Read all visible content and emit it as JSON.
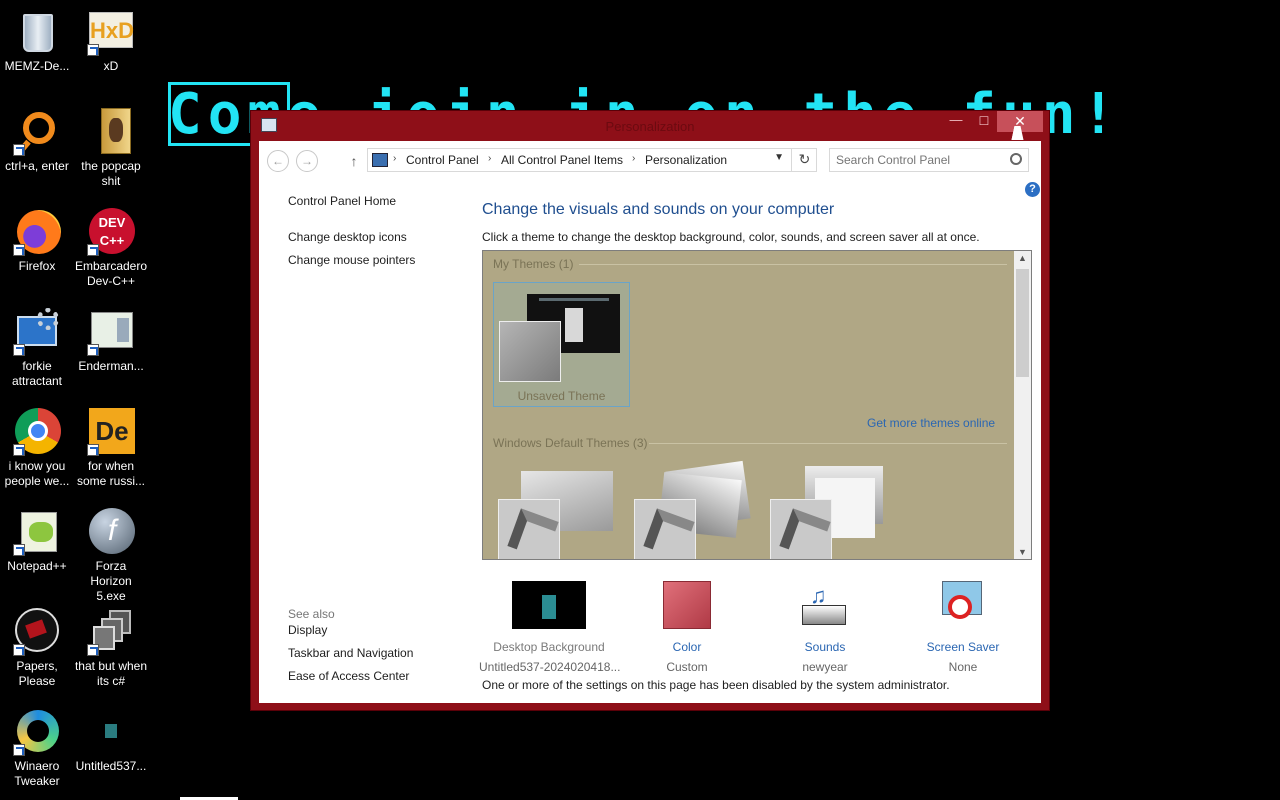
{
  "banner": {
    "text": "Come join in on the fun!"
  },
  "desktop_icons": [
    {
      "label": "MEMZ-De..."
    },
    {
      "label": "xD"
    },
    {
      "label": "ctrl+a, enter"
    },
    {
      "label": "the popcap shit"
    },
    {
      "label": "Firefox"
    },
    {
      "label": "Embarcadero Dev-C++"
    },
    {
      "label": "forkie attractant"
    },
    {
      "label": "Enderman..."
    },
    {
      "label": "i know you people we..."
    },
    {
      "label": "for when some russi..."
    },
    {
      "label": "Notepad++"
    },
    {
      "label": "Forza Horizon 5.exe"
    },
    {
      "label": "Papers, Please"
    },
    {
      "label": "that but when its c#"
    },
    {
      "label": "Winaero Tweaker"
    },
    {
      "label": "Untitled537..."
    }
  ],
  "window": {
    "title": "Personalization",
    "breadcrumb": [
      "Control Panel",
      "All Control Panel Items",
      "Personalization"
    ],
    "search_placeholder": "Search Control Panel",
    "left_pane": {
      "home": "Control Panel Home",
      "links": [
        "Change desktop icons",
        "Change mouse pointers"
      ],
      "see_also_title": "See also",
      "see_also": [
        "Display",
        "Taskbar and Navigation",
        "Ease of Access Center"
      ]
    },
    "heading": "Change the visuals and sounds on your computer",
    "description": "Click a theme to change the desktop background, color, sounds, and screen saver all at once.",
    "themes": {
      "my_themes_title": "My Themes (1)",
      "my_theme_name": "Unsaved Theme",
      "get_more": "Get more themes online",
      "default_title": "Windows Default Themes (3)"
    },
    "options": [
      {
        "name": "Desktop Background",
        "value": "Untitled537-2024020418..."
      },
      {
        "name": "Color",
        "value": "Custom"
      },
      {
        "name": "Sounds",
        "value": "newyear"
      },
      {
        "name": "Screen Saver",
        "value": "None"
      }
    ],
    "note": "One or more of the settings on this page has been disabled by the system administrator."
  },
  "colors": {
    "window_frame": "#8e0f18",
    "banner": "#22e4f4",
    "link": "#2a66b2",
    "theme_bg": "#b0a785",
    "color_swatch": "#c9505c"
  }
}
